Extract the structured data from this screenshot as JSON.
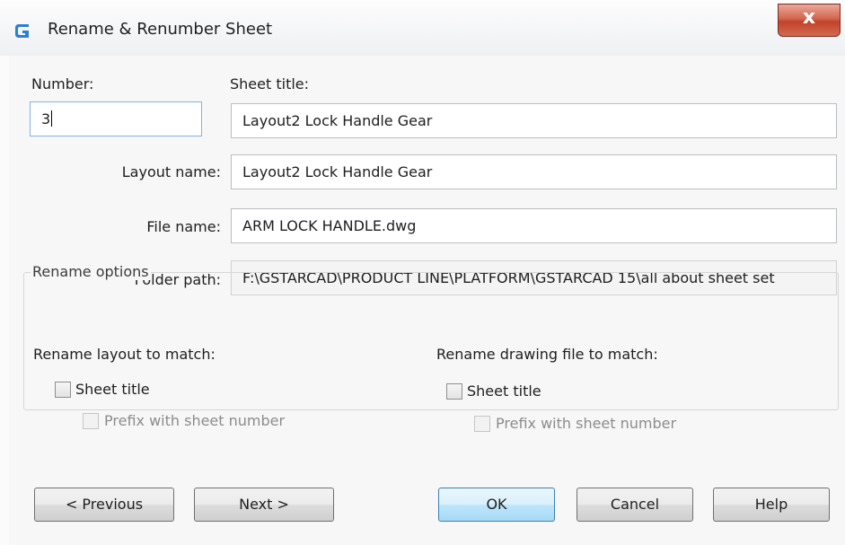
{
  "window": {
    "title": "Rename & Renumber Sheet",
    "close_glyph": "x",
    "icon": "gstarcad-logo-icon"
  },
  "form": {
    "number_label": "Number:",
    "number_value": "3",
    "sheet_title_label": "Sheet title:",
    "sheet_title_value": "Layout2 Lock Handle Gear",
    "layout_name_label": "Layout name:",
    "layout_name_value": "Layout2 Lock Handle Gear",
    "file_name_label": "File name:",
    "file_name_value": "ARM LOCK HANDLE.dwg",
    "folder_path_label": "Folder path:",
    "folder_path_value": "F:\\GSTARCAD\\PRODUCT LINE\\PLATFORM\\GSTARCAD 15\\all about sheet set"
  },
  "rename_options": {
    "legend": "Rename options",
    "layout": {
      "heading": "Rename layout to match:",
      "sheet_title_label": "Sheet title",
      "prefix_label": "Prefix with sheet number"
    },
    "drawing": {
      "heading": "Rename drawing file to match:",
      "sheet_title_label": "Sheet title",
      "prefix_label": "Prefix with sheet number"
    }
  },
  "buttons": {
    "previous": "< Previous",
    "next": "Next >",
    "ok": "OK",
    "cancel": "Cancel",
    "help": "Help"
  }
}
